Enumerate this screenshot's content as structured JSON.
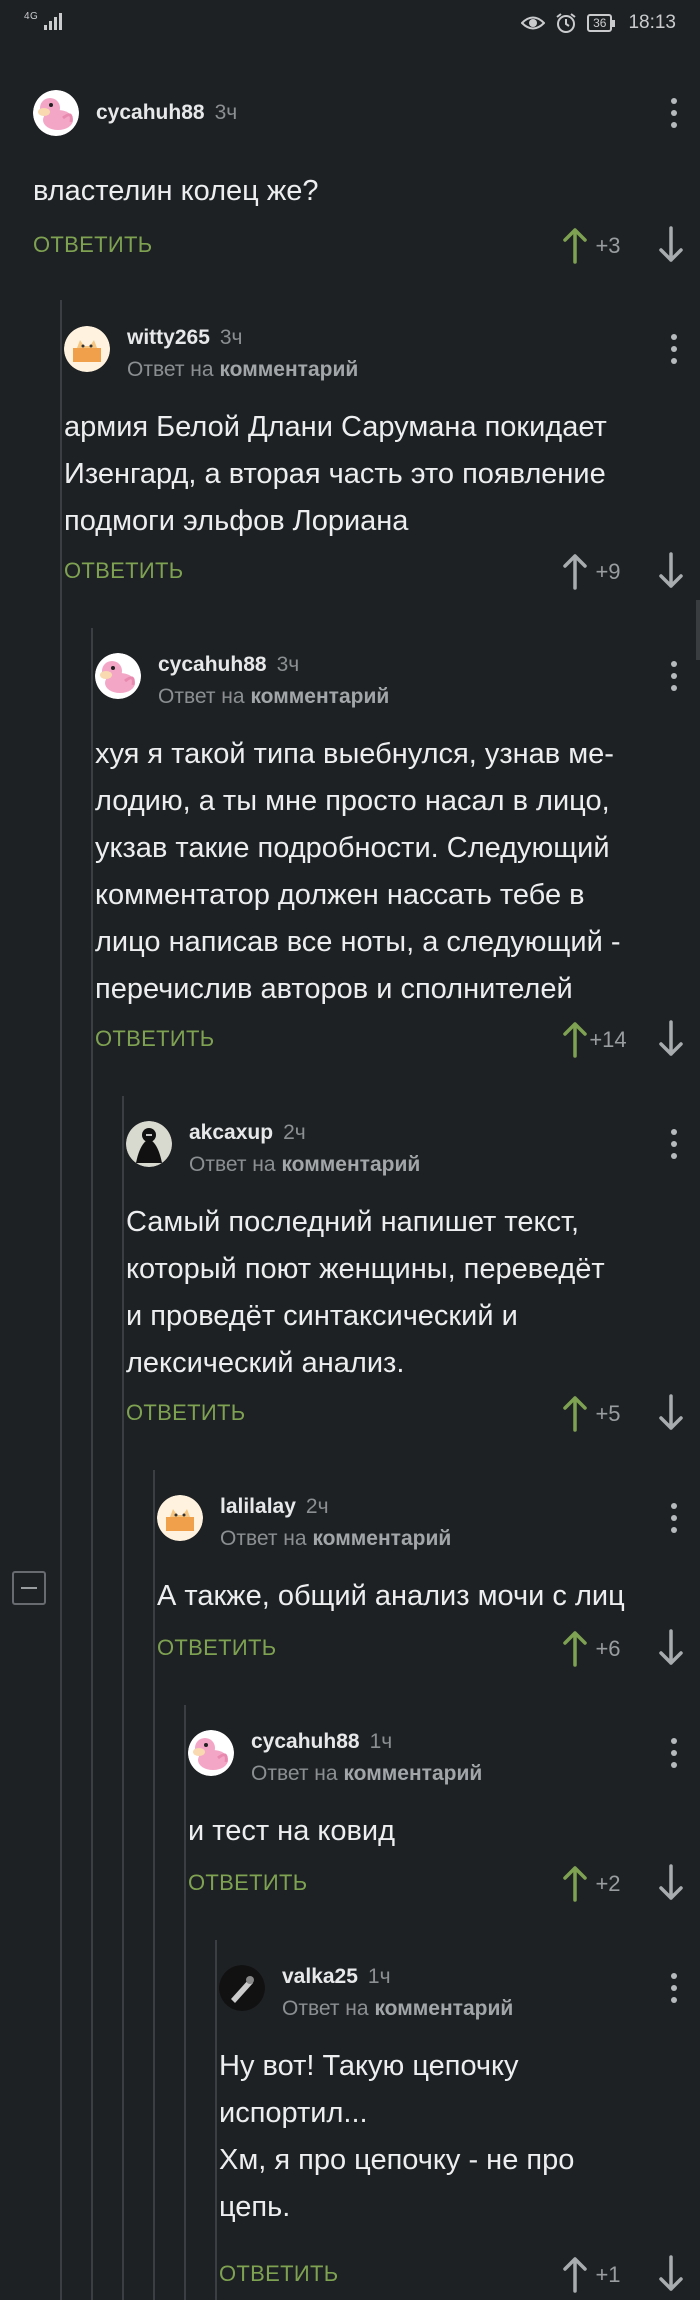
{
  "status": {
    "network": "4G",
    "time": "18:13",
    "battery": "36"
  },
  "labels": {
    "reply": "ОТВЕТИТЬ",
    "reply_to": "Ответ на",
    "comment": "комментарий"
  },
  "colors": {
    "accent": "#7ea251",
    "background": "#1e2124",
    "thread_line": "#3b3f43"
  },
  "comments": [
    {
      "author": "cycahuh88",
      "time": "3ч",
      "avatar": "pink-pokemon",
      "is_reply": false,
      "lines": [
        "властелин колец же?"
      ],
      "score": "+3",
      "upvoted": true
    },
    {
      "author": "witty265",
      "time": "3ч",
      "avatar": "cat-box",
      "is_reply": true,
      "lines": [
        "армия Белой Длани Сарумана покидает",
        "Изенгард, а вторая часть это появление",
        "подмоги эльфов Лориана"
      ],
      "score": "+9",
      "upvoted": false
    },
    {
      "author": "cycahuh88",
      "time": "3ч",
      "avatar": "pink-pokemon",
      "is_reply": true,
      "lines": [
        "хуя я такой типа выебнулся, узнав ме-",
        "лодию, а ты мне просто насал в лицо,",
        "укзав такие подробности. Следующий",
        "комментатор должен нассать тебе в",
        "лицо написав все ноты, а следующий -",
        "перечислив авторов и сполнителей"
      ],
      "score": "+14",
      "upvoted": true
    },
    {
      "author": "akcaxup",
      "time": "2ч",
      "avatar": "dark-figure",
      "is_reply": true,
      "lines": [
        "Самый последний напишет текст,",
        "который поют женщины, переведёт",
        "и проведёт синтаксический и",
        "лексический анализ."
      ],
      "score": "+5",
      "upvoted": true
    },
    {
      "author": "lalilalay",
      "time": "2ч",
      "avatar": "cat-box",
      "is_reply": true,
      "lines": [
        "А также, общий анализ мочи с лиц"
      ],
      "score": "+6",
      "upvoted": true
    },
    {
      "author": "cycahuh88",
      "time": "1ч",
      "avatar": "pink-pokemon",
      "is_reply": true,
      "lines": [
        "и тест на ковид"
      ],
      "score": "+2",
      "upvoted": true
    },
    {
      "author": "valka25",
      "time": "1ч",
      "avatar": "dark-silhouette",
      "is_reply": true,
      "lines": [
        "Ну вот! Такую цепочку",
        "испортил...",
        "Хм, я про цепочку - не про",
        "цепь."
      ],
      "score": "+1",
      "upvoted": false
    }
  ]
}
